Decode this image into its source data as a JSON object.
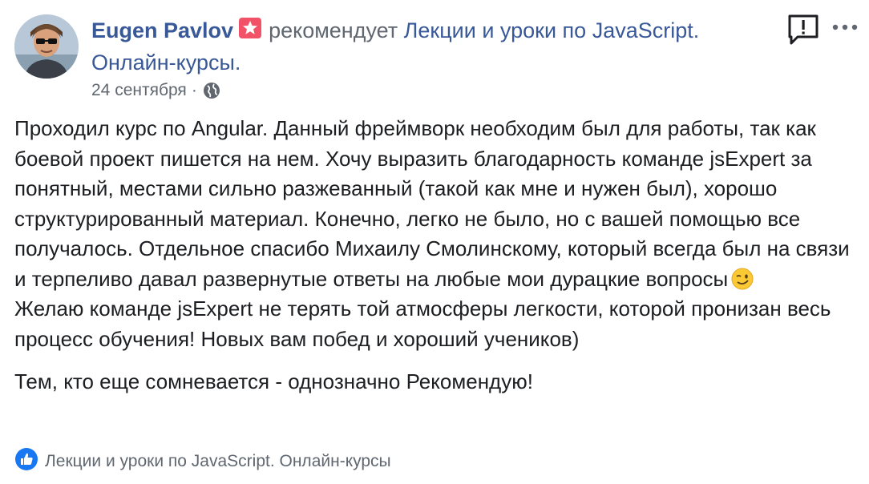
{
  "author": {
    "name": "Eugen Pavlov",
    "action": "рекомендует",
    "page_name": "Лекции и уроки по JavaScript. Онлайн-курсы.",
    "date": "24 сентября",
    "separator": "·",
    "privacy_icon": "globe-icon",
    "badge_icon": "recommendation-star-icon"
  },
  "post": {
    "paragraphs": [
      "Проходил курс по Angular. Данный фреймворк необходим был для работы, так как боевой проект пишется на нем. Хочу выразить благодарность команде jsExpert за понятный, местами сильно разжеванный (такой как мне и нужен был), хорошо структурированный материал. Конечно, легко не было, но с вашей помощью все получалось. Отдельное спасибо Михаилу Смолинскому, который всегда был на связи и терпеливо давал развернутые ответы на любые мои дурацкие вопросы",
      "Желаю команде jsExpert не терять той атмосферы легкости, которой пронизан весь процесс обучения! Новых вам побед и хороший учеников)",
      "Тем, кто еще сомневается - однозначно Рекомендую!"
    ],
    "emoji": "wink-emoji"
  },
  "footer": {
    "liked_by": "Лекции и уроки по JavaScript. Онлайн-курсы",
    "like_icon": "like-thumb-icon"
  },
  "controls": {
    "report_icon": "report-icon",
    "more_icon": "more-icon"
  },
  "colors": {
    "link": "#385898",
    "secondary": "#606770",
    "text": "#1c1e21",
    "badge": "#f25268",
    "like": "#1877f2"
  }
}
